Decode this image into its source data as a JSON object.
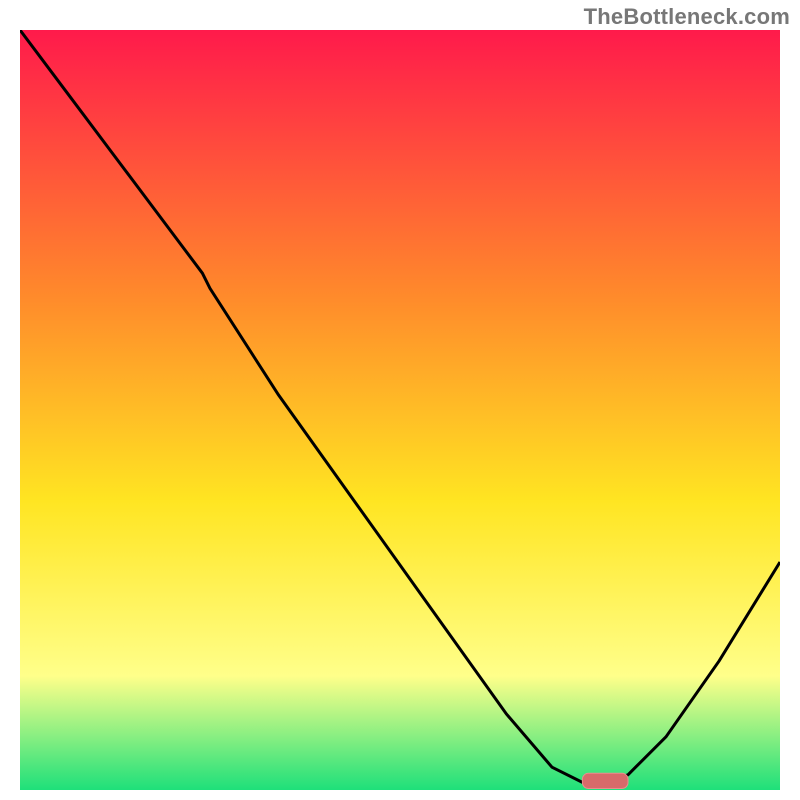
{
  "watermark": "TheBottleneck.com",
  "colors": {
    "gradient_top": "#ff1a4b",
    "gradient_mid1": "#ff8a2b",
    "gradient_mid2": "#ffe522",
    "gradient_mid3": "#ffff8a",
    "gradient_bottom": "#1ee07a",
    "curve": "#000000",
    "marker": "#d86a6a",
    "marker_highlight": "#e98e8e"
  },
  "chart_data": {
    "type": "line",
    "title": "",
    "xlabel": "",
    "ylabel": "",
    "xlim": [
      0,
      100
    ],
    "ylim": [
      0,
      100
    ],
    "note": "Axis units are percent of plot area. y=0 is the bottom (green band), y=100 is the top (red). Values estimated from the figure.",
    "series": [
      {
        "name": "curve",
        "x": [
          0,
          6,
          12,
          18,
          24,
          25,
          34,
          44,
          54,
          64,
          70,
          74,
          77,
          80,
          85,
          92,
          100
        ],
        "y": [
          100,
          92,
          84,
          76,
          68,
          66,
          52,
          38,
          24,
          10,
          3,
          1,
          1,
          2,
          7,
          17,
          30
        ]
      }
    ],
    "marker": {
      "name": "optimum-band",
      "x_start": 74,
      "x_end": 80,
      "y": 1.2,
      "thickness_pct": 2.0
    },
    "gradient_stops_pct": [
      {
        "offset": 0,
        "color": "#ff1a4b"
      },
      {
        "offset": 35,
        "color": "#ff8a2b"
      },
      {
        "offset": 62,
        "color": "#ffe522"
      },
      {
        "offset": 85,
        "color": "#ffff8a"
      },
      {
        "offset": 100,
        "color": "#1ee07a"
      }
    ]
  }
}
